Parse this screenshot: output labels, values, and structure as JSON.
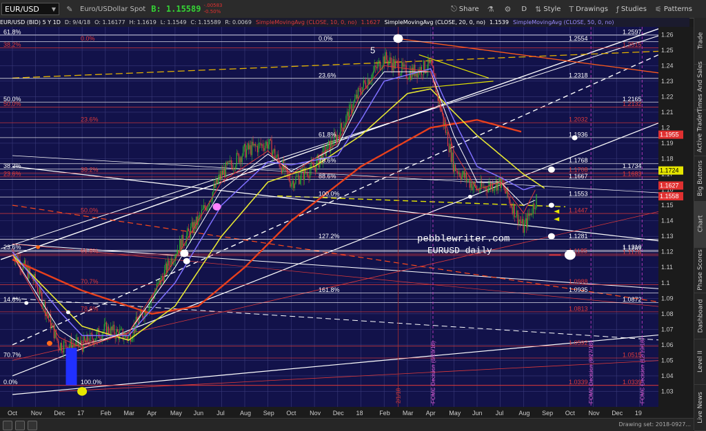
{
  "topbar": {
    "symbol": "EUR/USD",
    "description": "Euro/USDollar Spot",
    "bid": "B: 1.15589",
    "change": "-.00583",
    "change_pct": "-0.50%",
    "buttons": [
      {
        "name": "share-button",
        "label": "Share",
        "icon": "share-icon",
        "glyph": "⎋"
      },
      {
        "name": "lab-button",
        "label": "",
        "icon": "flask-icon",
        "glyph": "⚗"
      },
      {
        "name": "settings-button",
        "label": "",
        "icon": "gear-icon",
        "glyph": "⚙"
      },
      {
        "name": "period-button",
        "label": "D",
        "icon": "",
        "glyph": ""
      },
      {
        "name": "style-button",
        "label": "Style",
        "icon": "chart-style-icon",
        "glyph": "⇅"
      },
      {
        "name": "drawings-button",
        "label": "Drawings",
        "icon": "drawing-icon",
        "glyph": "T"
      },
      {
        "name": "studies-button",
        "label": "Studies",
        "icon": "studies-icon",
        "glyph": "ƒ"
      },
      {
        "name": "patterns-button",
        "label": "Patterns",
        "icon": "patterns-icon",
        "glyph": "⚟"
      }
    ]
  },
  "infobar": [
    {
      "text": "EUR/USD (BID) 5 Y 1D",
      "color": "#ffffff"
    },
    {
      "text": "D: 9/4/18",
      "color": "#cccccc"
    },
    {
      "text": "O: 1.16177",
      "color": "#cccccc"
    },
    {
      "text": "H: 1.1619",
      "color": "#cccccc"
    },
    {
      "text": "L: 1.1549",
      "color": "#cccccc"
    },
    {
      "text": "C: 1.15589",
      "color": "#cccccc"
    },
    {
      "text": "R: 0.0069",
      "color": "#cccccc"
    },
    {
      "text": "SimpleMovingAvg (CLOSE, 10, 0, no)",
      "color": "#e03a3a"
    },
    {
      "text": "1.1627",
      "color": "#e03a3a"
    },
    {
      "text": "SimpleMovingAvg (CLOSE, 20, 0, no)",
      "color": "#ffffff"
    },
    {
      "text": "1.1539",
      "color": "#ffffff"
    },
    {
      "text": "SimpleMovingAvg (CLOSE, 50, 0, no)",
      "color": "#9a8cff"
    }
  ],
  "right_tabs": [
    "Trade",
    "Times And Sales",
    "Active Trader",
    "Big Buttons",
    "Chart",
    "Phase Scores",
    "Dashboard",
    "Level II",
    "Live News"
  ],
  "bottombar": {
    "drawing_set": "Drawing set: 2018-0927..."
  },
  "colors": {
    "background": "#12124a",
    "grid": "#3a3a7a",
    "up": "#2db82d",
    "down": "#e04040"
  },
  "chart_data": {
    "type": "candlestick",
    "title": "pebblewriter.com",
    "subtitle": "EURUSD daily",
    "ylim": [
      1.02,
      1.265
    ],
    "x_labels": [
      "Oct",
      "Nov",
      "Dec",
      "17",
      "Feb",
      "Mar",
      "Apr",
      "May",
      "Jun",
      "Jul",
      "Aug",
      "Sep",
      "Oct",
      "Nov",
      "Dec",
      "18",
      "Feb",
      "Mar",
      "Apr",
      "May",
      "Jun",
      "Jul",
      "Aug",
      "Sep",
      "Oct",
      "Nov",
      "Dec",
      "19"
    ],
    "y_ticks": [
      "1.26",
      "1.25",
      "1.24",
      "1.23",
      "1.22",
      "1.21",
      "1.2",
      "1.19",
      "1.18",
      "1.17",
      "1.16",
      "1.15",
      "1.14",
      "1.13",
      "1.12",
      "1.11",
      "1.1",
      "1.09",
      "1.08",
      "1.07",
      "1.06",
      "1.05",
      "1.04",
      "1.03"
    ],
    "price_series": [
      {
        "month": 0,
        "close": 1.12
      },
      {
        "month": 1,
        "close": 1.1
      },
      {
        "month": 2,
        "close": 1.06
      },
      {
        "month": 3,
        "close": 1.06
      },
      {
        "month": 4,
        "close": 1.07
      },
      {
        "month": 5,
        "close": 1.065
      },
      {
        "month": 6,
        "close": 1.09
      },
      {
        "month": 7,
        "close": 1.12
      },
      {
        "month": 8,
        "close": 1.14
      },
      {
        "month": 9,
        "close": 1.17
      },
      {
        "month": 10,
        "close": 1.185
      },
      {
        "month": 11,
        "close": 1.19
      },
      {
        "month": 12,
        "close": 1.165
      },
      {
        "month": 13,
        "close": 1.175
      },
      {
        "month": 14,
        "close": 1.195
      },
      {
        "month": 15,
        "close": 1.225
      },
      {
        "month": 16,
        "close": 1.245
      },
      {
        "month": 17,
        "close": 1.235
      },
      {
        "month": 18,
        "close": 1.24
      },
      {
        "month": 19,
        "close": 1.175
      },
      {
        "month": 20,
        "close": 1.16
      },
      {
        "month": 21,
        "close": 1.165
      },
      {
        "month": 22,
        "close": 1.135
      },
      {
        "month": 22.6,
        "close": 1.156
      }
    ],
    "sma10": [
      [
        0,
        1.118
      ],
      [
        2,
        1.065
      ],
      [
        3,
        1.058
      ],
      [
        5,
        1.068
      ],
      [
        7,
        1.115
      ],
      [
        9,
        1.165
      ],
      [
        11,
        1.185
      ],
      [
        12,
        1.17
      ],
      [
        14,
        1.19
      ],
      [
        15,
        1.222
      ],
      [
        16,
        1.24
      ],
      [
        18,
        1.236
      ],
      [
        19,
        1.185
      ],
      [
        20,
        1.16
      ],
      [
        21,
        1.165
      ],
      [
        22,
        1.145
      ],
      [
        22.6,
        1.1627
      ]
    ],
    "sma20": [
      [
        0,
        1.118
      ],
      [
        2,
        1.07
      ],
      [
        3,
        1.06
      ],
      [
        5,
        1.068
      ],
      [
        7,
        1.11
      ],
      [
        9,
        1.16
      ],
      [
        11,
        1.183
      ],
      [
        12,
        1.172
      ],
      [
        14,
        1.188
      ],
      [
        15,
        1.218
      ],
      [
        16,
        1.236
      ],
      [
        18,
        1.236
      ],
      [
        19,
        1.195
      ],
      [
        20,
        1.165
      ],
      [
        21,
        1.165
      ],
      [
        22,
        1.15
      ],
      [
        22.6,
        1.1539
      ]
    ],
    "sma50": [
      [
        0,
        1.12
      ],
      [
        2,
        1.082
      ],
      [
        3,
        1.066
      ],
      [
        5,
        1.066
      ],
      [
        7,
        1.1
      ],
      [
        9,
        1.15
      ],
      [
        11,
        1.178
      ],
      [
        12,
        1.176
      ],
      [
        14,
        1.182
      ],
      [
        15,
        1.205
      ],
      [
        16,
        1.23
      ],
      [
        18,
        1.238
      ],
      [
        19,
        1.205
      ],
      [
        20,
        1.175
      ],
      [
        21,
        1.168
      ],
      [
        22,
        1.16
      ],
      [
        22.6,
        1.1627
      ]
    ],
    "sma100": [
      [
        0,
        1.118
      ],
      [
        3,
        1.072
      ],
      [
        5,
        1.063
      ],
      [
        7,
        1.085
      ],
      [
        9,
        1.13
      ],
      [
        11,
        1.165
      ],
      [
        13,
        1.175
      ],
      [
        15,
        1.195
      ],
      [
        17,
        1.222
      ],
      [
        18,
        1.225
      ],
      [
        20,
        1.195
      ],
      [
        22,
        1.17
      ],
      [
        23,
        1.16
      ]
    ],
    "sma200": [
      [
        0,
        1.115
      ],
      [
        3,
        1.095
      ],
      [
        6,
        1.08
      ],
      [
        8,
        1.085
      ],
      [
        10,
        1.11
      ],
      [
        12,
        1.14
      ],
      [
        15,
        1.175
      ],
      [
        18,
        1.2
      ],
      [
        20,
        1.205
      ],
      [
        22,
        1.197
      ]
    ],
    "hlines": [
      {
        "y": 1.2597,
        "label": "1.2597",
        "color": "#ffffff",
        "right": true
      },
      {
        "y": 1.2554,
        "label": "1.2554",
        "color": "#ffffff"
      },
      {
        "y": 1.2515,
        "label": "1.2515",
        "color": "#e03a3a",
        "right": true
      },
      {
        "y": 1.2318,
        "label": "1.2318",
        "color": "#ffffff"
      },
      {
        "y": 1.2165,
        "label": "1.2165",
        "color": "#ffffff",
        "right": true
      },
      {
        "y": 1.2132,
        "label": "1.2132",
        "color": "#e03a3a",
        "right": true
      },
      {
        "y": 1.2032,
        "label": "1.2032",
        "color": "#e03a3a"
      },
      {
        "y": 1.1936,
        "label": "1.1936",
        "color": "#ffffff"
      },
      {
        "y": 1.1768,
        "label": "1.1768",
        "color": "#ffffff"
      },
      {
        "y": 1.1734,
        "label": "1.1734",
        "color": "#ffffff",
        "right": true
      },
      {
        "y": 1.1708,
        "label": "1.1708",
        "color": "#e03a3a"
      },
      {
        "y": 1.1683,
        "label": "1.1683",
        "color": "#e03a3a",
        "right": true
      },
      {
        "y": 1.1667,
        "label": "1.1667",
        "color": "#ffffff"
      },
      {
        "y": 1.1553,
        "label": "1.1553",
        "color": "#ffffff"
      },
      {
        "y": 1.1447,
        "label": "1.1447",
        "color": "#e03a3a"
      },
      {
        "y": 1.1281,
        "label": "1.1281",
        "color": "#ffffff"
      },
      {
        "y": 1.121,
        "label": "1.1210",
        "color": "#ffffff",
        "right": true
      },
      {
        "y": 1.1201,
        "label": "1.1201",
        "color": "#ffffff",
        "right": true
      },
      {
        "y": 1.1185,
        "label": "1.1185",
        "color": "#e03a3a"
      },
      {
        "y": 1.1176,
        "label": "1.1176",
        "color": "#e03a3a",
        "right": true
      },
      {
        "y": 1.0988,
        "label": "1.0988",
        "color": "#e03a3a"
      },
      {
        "y": 1.0935,
        "label": "1.0935",
        "color": "#ffffff"
      },
      {
        "y": 1.0872,
        "label": "1.0872",
        "color": "#ffffff",
        "right": true
      },
      {
        "y": 1.0813,
        "label": "1.0813",
        "color": "#e03a3a"
      },
      {
        "y": 1.0592,
        "label": "1.0592",
        "color": "#e03a3a"
      },
      {
        "y": 1.0515,
        "label": "1.0515",
        "color": "#e03a3a",
        "right": true
      },
      {
        "y": 1.0339,
        "label": "1.0339",
        "color": "#e03a3a"
      },
      {
        "y": 1.0339,
        "label": "1.0339",
        "color": "#e03a3a",
        "right": true
      }
    ],
    "fib_labels": [
      {
        "text": "61.8%",
        "y": 1.2597,
        "color": "#ffffff",
        "side": "left"
      },
      {
        "text": "0.0%",
        "y": 1.2554,
        "color": "#e03a3a",
        "side": "mid1"
      },
      {
        "text": "0.0%",
        "y": 1.2554,
        "color": "#ffffff",
        "side": "mid2"
      },
      {
        "text": "38.2%",
        "y": 1.2515,
        "color": "#e03a3a",
        "side": "left"
      },
      {
        "text": "23.6%",
        "y": 1.2318,
        "color": "#ffffff",
        "side": "mid2"
      },
      {
        "text": "50.0%",
        "y": 1.2165,
        "color": "#ffffff",
        "side": "left"
      },
      {
        "text": "50.0%",
        "y": 1.2132,
        "color": "#e03a3a",
        "side": "left"
      },
      {
        "text": "23.6%",
        "y": 1.2032,
        "color": "#e03a3a",
        "side": "mid1"
      },
      {
        "text": "61.8%",
        "y": 1.1936,
        "color": "#ffffff",
        "side": "mid2"
      },
      {
        "text": "78.6%",
        "y": 1.1768,
        "color": "#ffffff",
        "side": "mid2"
      },
      {
        "text": "38.2%",
        "y": 1.1734,
        "color": "#ffffff",
        "side": "left"
      },
      {
        "text": "38.2%",
        "y": 1.1708,
        "color": "#e03a3a",
        "side": "mid1"
      },
      {
        "text": "23.6%",
        "y": 1.1683,
        "color": "#e03a3a",
        "side": "left"
      },
      {
        "text": "88.6%",
        "y": 1.1667,
        "color": "#ffffff",
        "side": "mid2"
      },
      {
        "text": "100.0%",
        "y": 1.1553,
        "color": "#ffffff",
        "side": "mid2"
      },
      {
        "text": "50.0%",
        "y": 1.1447,
        "color": "#e03a3a",
        "side": "mid1"
      },
      {
        "text": "127.2%",
        "y": 1.1281,
        "color": "#ffffff",
        "side": "mid2"
      },
      {
        "text": "23.6%",
        "y": 1.121,
        "color": "#ffffff",
        "side": "left"
      },
      {
        "text": "61.8%",
        "y": 1.1185,
        "color": "#e03a3a",
        "side": "mid1"
      },
      {
        "text": "70.7%",
        "y": 1.0988,
        "color": "#e03a3a",
        "side": "mid1"
      },
      {
        "text": "161.8%",
        "y": 1.0935,
        "color": "#ffffff",
        "side": "mid2"
      },
      {
        "text": "14.6%",
        "y": 1.0872,
        "color": "#ffffff",
        "side": "left"
      },
      {
        "text": "78.6%",
        "y": 1.0813,
        "color": "#e03a3a",
        "side": "mid1"
      },
      {
        "text": "88.6%",
        "y": 1.0592,
        "color": "#e03a3a",
        "side": "mid1"
      },
      {
        "text": "70.7%",
        "y": 1.0515,
        "color": "#ffffff",
        "side": "left"
      },
      {
        "text": "100.0%",
        "y": 1.0339,
        "color": "#ffffff",
        "side": "mid1"
      },
      {
        "text": "0.0%",
        "y": 1.0339,
        "color": "#ffffff",
        "side": "left"
      }
    ],
    "price_bubbles": [
      {
        "y": 1.1955,
        "label": "1.1955",
        "bg": "#e03030",
        "fg": "#ffffff"
      },
      {
        "y": 1.1724,
        "label": "1.1724",
        "bg": "#e6e600",
        "fg": "#000000"
      },
      {
        "y": 1.1627,
        "label": "1.1627",
        "bg": "#e03030",
        "fg": "#ffffff"
      },
      {
        "y": 1.1558,
        "label": "1.1558",
        "bg": "#e03030",
        "fg": "#ffffff"
      }
    ],
    "vertical_events": [
      {
        "month": 18.1,
        "label": "FOMC Decision (3/20/18)"
      },
      {
        "month": 24.9,
        "label": "FOMC Decision (9/27/18)"
      },
      {
        "month": 27.1,
        "label": "FOMC Decision (12/19/18)"
      },
      {
        "month": 16.6,
        "label": "2/1/18"
      }
    ],
    "annotations": [
      {
        "text": "5"
      }
    ]
  }
}
